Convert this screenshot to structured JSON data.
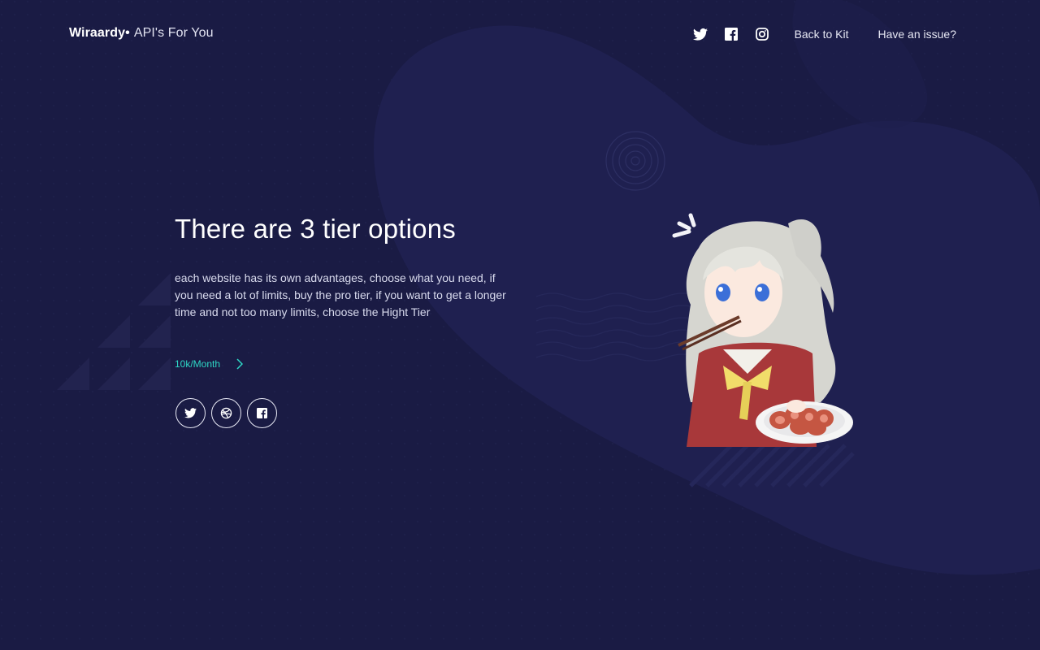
{
  "header": {
    "brand_name": "Wiraardy",
    "brand_dot": "•",
    "brand_tagline": "API's For You",
    "nav_icons": [
      "twitter-icon",
      "facebook-icon",
      "instagram-icon"
    ],
    "nav_links": [
      "Back to Kit",
      "Have an issue?"
    ]
  },
  "hero": {
    "title": "There are 3 tier options",
    "description": "each website has its own advantages, choose what you need, if you need a lot of limits, buy the pro tier, if you want to get a longer time and not too many limits, choose the Hight Tier",
    "tier_link": "10k/Month",
    "social_icons": [
      "twitter-icon",
      "dribbble-icon",
      "facebook-icon"
    ]
  },
  "colors": {
    "background": "#1a1b44",
    "blob": "#1f2050",
    "accent": "#2ed8c6",
    "text": "#ffffff"
  }
}
